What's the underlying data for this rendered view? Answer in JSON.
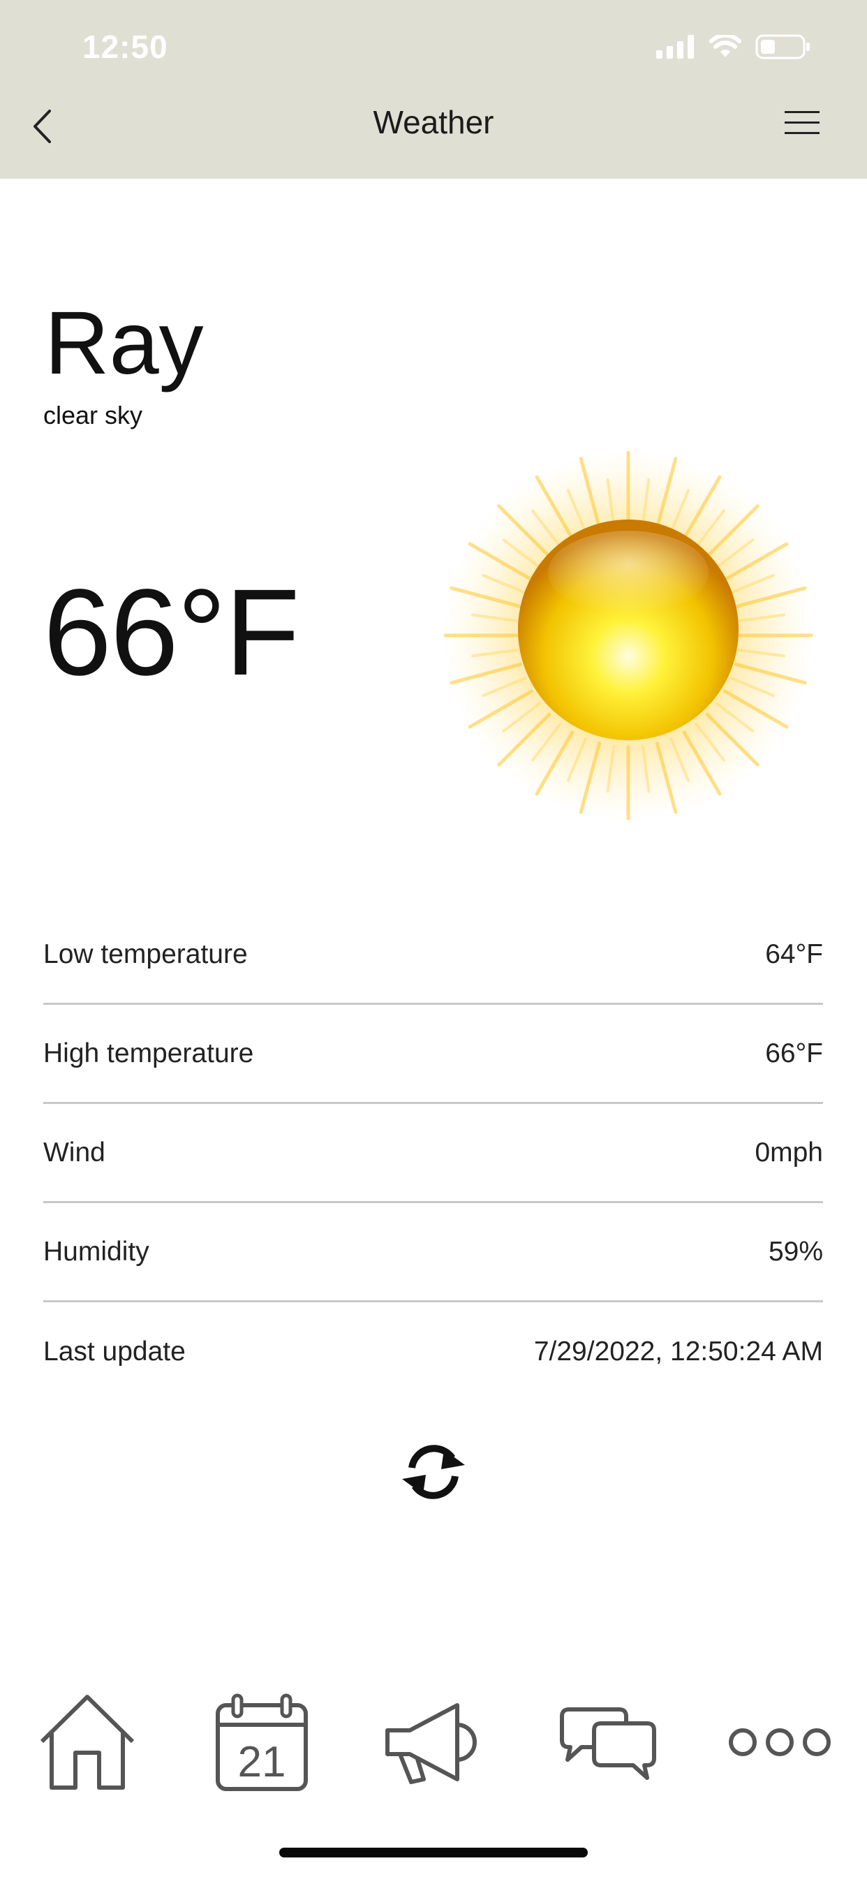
{
  "status_bar": {
    "time": "12:50"
  },
  "nav": {
    "title": "Weather"
  },
  "weather": {
    "location": "Ray",
    "description": "clear sky",
    "temperature": "66°F",
    "condition_icon": "sun-icon"
  },
  "details": [
    {
      "label": "Low temperature",
      "value": "64°F"
    },
    {
      "label": "High temperature",
      "value": "66°F"
    },
    {
      "label": "Wind",
      "value": "0mph"
    },
    {
      "label": "Humidity",
      "value": "59%"
    },
    {
      "label": "Last update",
      "value": "7/29/2022, 12:50:24 AM"
    }
  ],
  "tabbar": {
    "items": [
      {
        "icon": "home-icon"
      },
      {
        "icon": "calendar-icon",
        "text": "21"
      },
      {
        "icon": "megaphone-icon"
      },
      {
        "icon": "chat-icon"
      },
      {
        "icon": "more-icon"
      }
    ]
  },
  "colors": {
    "header_bg": "#e0dfd4",
    "divider": "#c8c8c8",
    "icon_gray": "#555555"
  }
}
